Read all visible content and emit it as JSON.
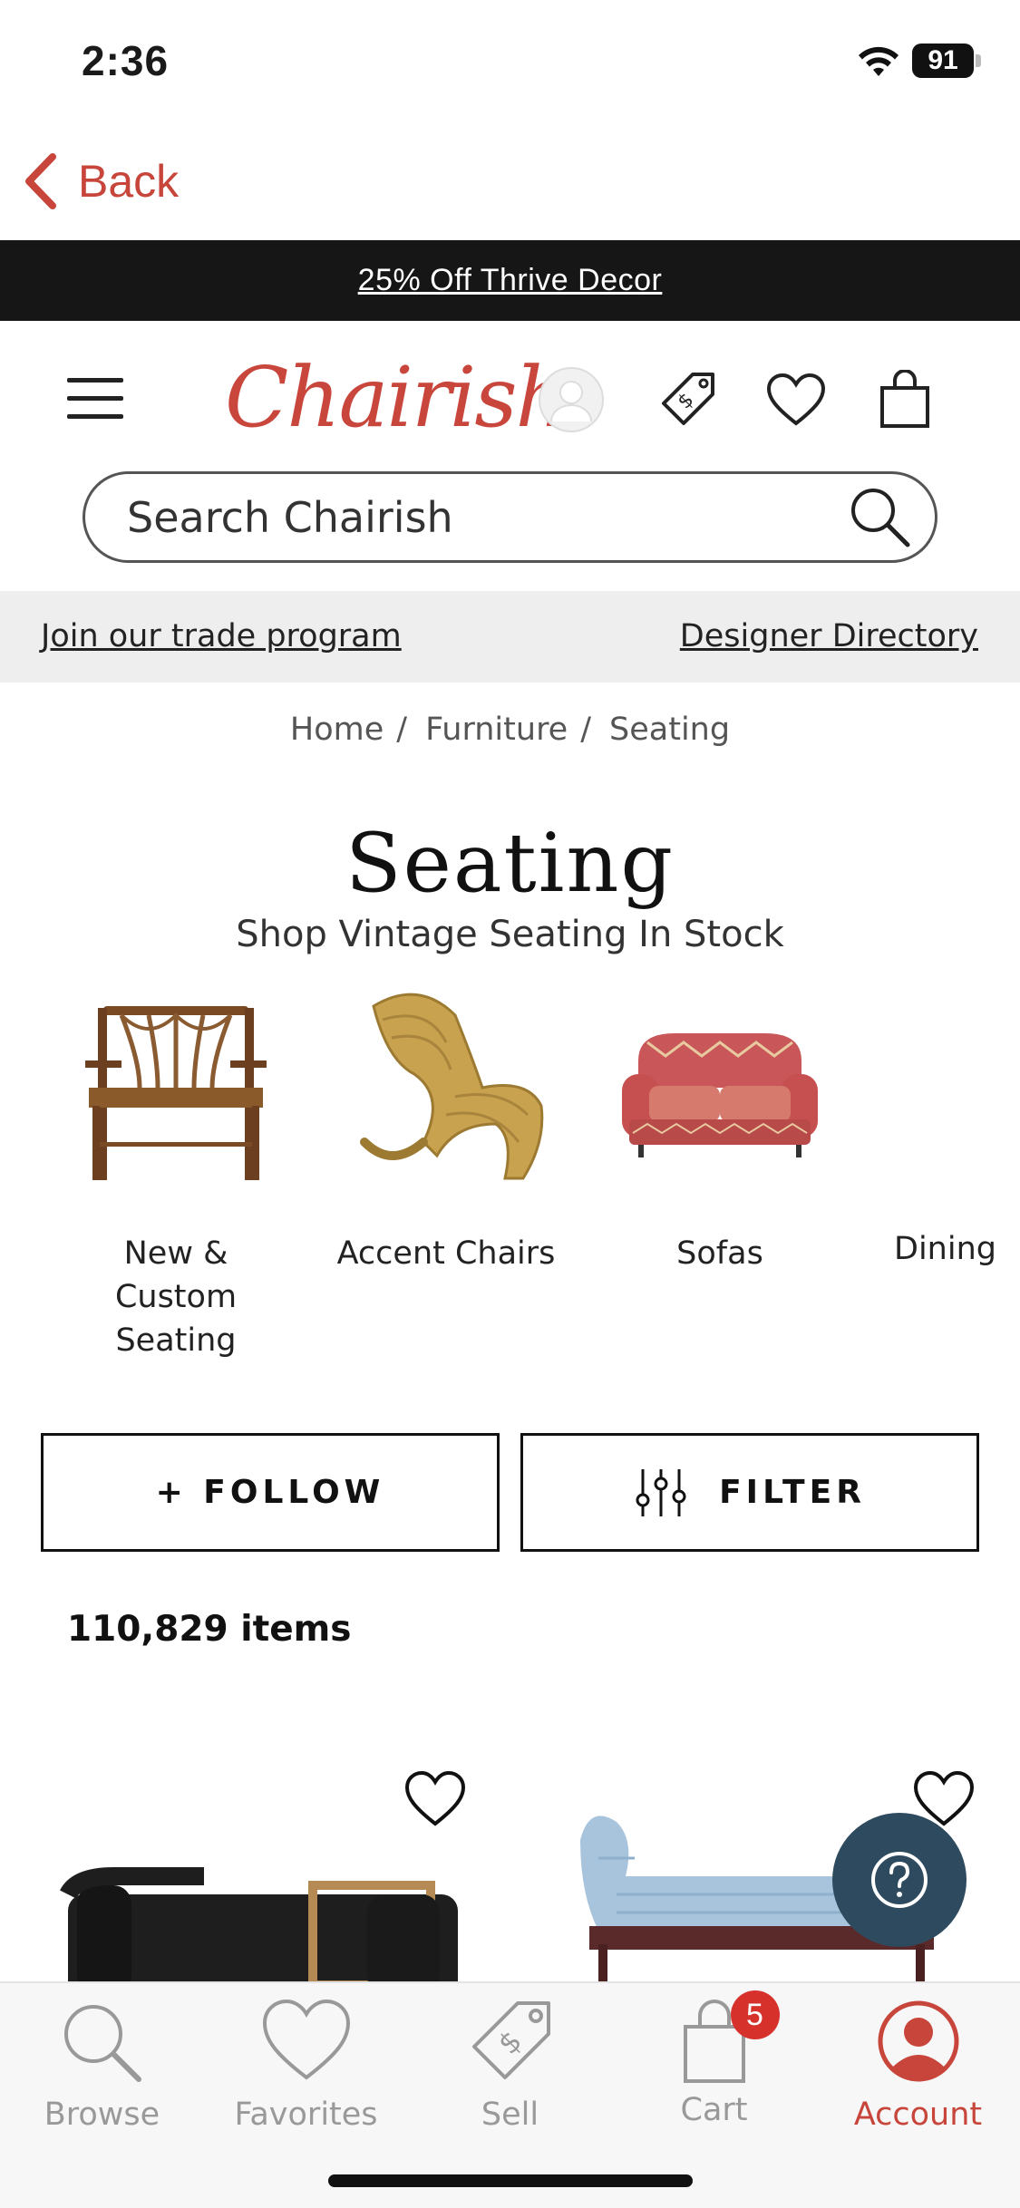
{
  "status": {
    "time": "2:36",
    "battery": "91"
  },
  "nav": {
    "back_label": "Back"
  },
  "promo": {
    "text": "25% Off Thrive Decor"
  },
  "header": {
    "logo_text": "Chairish"
  },
  "search": {
    "placeholder": "Search Chairish"
  },
  "trade": {
    "left_link": "Join our trade program",
    "right_link": "Designer Directory"
  },
  "breadcrumb": {
    "items": [
      "Home",
      "Furniture",
      "Seating"
    ],
    "separator": "/"
  },
  "page": {
    "title": "Seating",
    "subtitle": "Shop Vintage Seating In Stock"
  },
  "categories": [
    {
      "label": "New & Custom Seating",
      "image": "wooden-bench"
    },
    {
      "label": "Accent Chairs",
      "image": "wicker-chair"
    },
    {
      "label": "Sofas",
      "image": "patterned-loveseat"
    },
    {
      "label": "Dining",
      "image": "dining-chair"
    }
  ],
  "actions": {
    "follow_label": "+ FOLLOW",
    "filter_label": "FILTER"
  },
  "results": {
    "count_text": "110,829 items"
  },
  "tabbar": {
    "items": [
      {
        "label": "Browse",
        "icon": "search-icon"
      },
      {
        "label": "Favorites",
        "icon": "heart-icon"
      },
      {
        "label": "Sell",
        "icon": "price-tag-icon"
      },
      {
        "label": "Cart",
        "icon": "shopping-bag-icon",
        "badge": "5"
      },
      {
        "label": "Account",
        "icon": "account-icon",
        "active": true
      }
    ]
  },
  "colors": {
    "accent": "#c7453a",
    "promo_bg": "#161616",
    "help_fab": "#2e4a5e",
    "badge": "#d6322b"
  }
}
